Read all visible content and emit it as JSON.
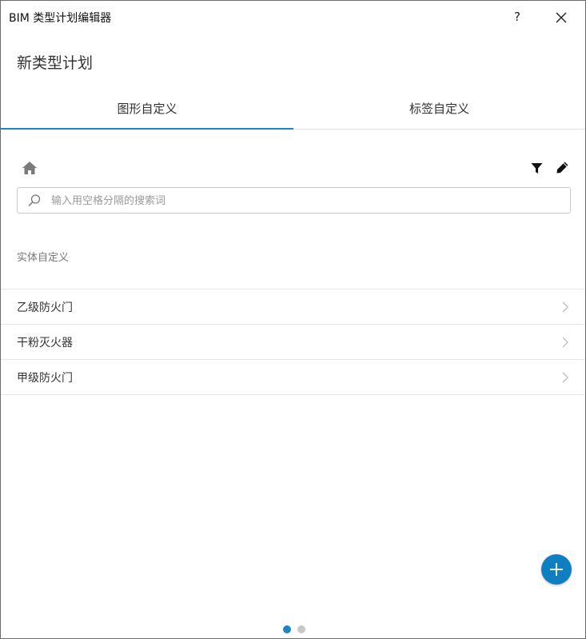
{
  "window": {
    "title": "BIM 类型计划编辑器",
    "help_label": "?"
  },
  "page": {
    "title": "新类型计划"
  },
  "tabs": [
    {
      "label": "图形自定义",
      "active": true
    },
    {
      "label": "标签自定义",
      "active": false
    }
  ],
  "toolbar": {
    "home_icon": "home-icon",
    "filter_icon": "filter-icon",
    "edit_icon": "pencil-icon"
  },
  "search": {
    "placeholder": "输入用空格分隔的搜索词",
    "value": ""
  },
  "section": {
    "label": "实体自定义"
  },
  "items": [
    {
      "label": "乙级防火门"
    },
    {
      "label": "干粉灭火器"
    },
    {
      "label": "甲级防火门"
    }
  ],
  "fab": {
    "icon": "plus-icon"
  },
  "pager": {
    "total": 2,
    "current": 1
  },
  "colors": {
    "accent": "#1a86c4",
    "fab": "#0f7fc1",
    "border": "#e6e6e6"
  }
}
